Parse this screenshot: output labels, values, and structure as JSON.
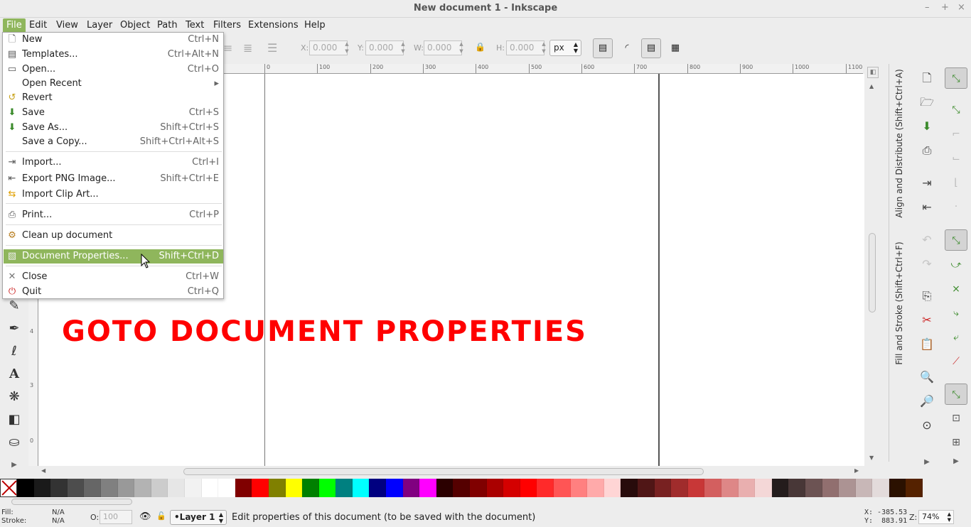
{
  "window": {
    "title": "New document 1 - Inkscape",
    "controls": [
      "–",
      "+",
      "×"
    ]
  },
  "menubar": [
    "File",
    "Edit",
    "View",
    "Layer",
    "Object",
    "Path",
    "Text",
    "Filters",
    "Extensions",
    "Help"
  ],
  "file_menu": {
    "items": [
      {
        "label": "New",
        "shortcut": "Ctrl+N",
        "icon": "new-document-icon"
      },
      {
        "label": "Templates...",
        "shortcut": "Ctrl+Alt+N",
        "icon": "templates-icon"
      },
      {
        "label": "Open...",
        "shortcut": "Ctrl+O",
        "icon": "open-folder-icon"
      },
      {
        "label": "Open Recent",
        "shortcut": "▸",
        "icon": ""
      },
      {
        "label": "Revert",
        "shortcut": "",
        "icon": "revert-icon"
      },
      {
        "label": "Save",
        "shortcut": "Ctrl+S",
        "icon": "save-icon"
      },
      {
        "label": "Save As...",
        "shortcut": "Shift+Ctrl+S",
        "icon": "save-as-icon"
      },
      {
        "label": "Save a Copy...",
        "shortcut": "Shift+Ctrl+Alt+S",
        "icon": ""
      },
      {
        "label": "Import...",
        "shortcut": "Ctrl+I",
        "icon": "import-icon"
      },
      {
        "label": "Export PNG Image...",
        "shortcut": "Shift+Ctrl+E",
        "icon": "export-png-icon"
      },
      {
        "label": "Import Clip Art...",
        "shortcut": "",
        "icon": "clip-art-icon"
      },
      {
        "label": "Print...",
        "shortcut": "Ctrl+P",
        "icon": "print-icon"
      },
      {
        "label": "Clean up document",
        "shortcut": "",
        "icon": "cleanup-icon"
      },
      {
        "label": "Document Properties...",
        "shortcut": "Shift+Ctrl+D",
        "icon": "document-properties-icon"
      },
      {
        "label": "Close",
        "shortcut": "Ctrl+W",
        "icon": "close-icon"
      },
      {
        "label": "Quit",
        "shortcut": "Ctrl+Q",
        "icon": "quit-icon"
      }
    ]
  },
  "toolbar": {
    "x_label": "X:",
    "x_value": "0.000",
    "y_label": "Y:",
    "y_value": "0.000",
    "w_label": "W:",
    "w_value": "0.000",
    "h_label": "H:",
    "h_value": "0.000",
    "unit": "px"
  },
  "ruler_ticks": [
    "0",
    "100",
    "200",
    "300",
    "400",
    "500",
    "600",
    "700",
    "800",
    "900",
    "1000",
    "1100"
  ],
  "vruler_ticks": [
    "4",
    "3",
    "0"
  ],
  "canvas": {
    "text": "GOTO DOCUMENT PROPERTIES",
    "text_color": "#ff0000"
  },
  "dock": {
    "align_tab": "Align and Distribute (Shift+Ctrl+A)",
    "fill_tab": "Fill and Stroke (Shift+Ctrl+F)"
  },
  "palette": [
    "#000000",
    "#1a1a1a",
    "#333333",
    "#4d4d4d",
    "#666666",
    "#808080",
    "#999999",
    "#b3b3b3",
    "#cccccc",
    "#e6e6e6",
    "#f2f2f2",
    "#ffffff",
    "#ffffff",
    "#800000",
    "#ff0000",
    "#808000",
    "#ffff00",
    "#008000",
    "#00ff00",
    "#008080",
    "#00ffff",
    "#000080",
    "#0000ff",
    "#800080",
    "#ff00ff",
    "#2b0000",
    "#550000",
    "#800000",
    "#aa0000",
    "#d40000",
    "#ff0000",
    "#ff2a2a",
    "#ff5555",
    "#ff8080",
    "#ffaaaa",
    "#ffd5d5",
    "#280b0b",
    "#501616",
    "#782121",
    "#a02c2c",
    "#c83737",
    "#d35f5f",
    "#de8787",
    "#e9afaf",
    "#f4d7d7",
    "#241c1c",
    "#483737",
    "#6c5353",
    "#916f6f",
    "#ac9393",
    "#c8b7b7",
    "#e3dbdb",
    "#2b1100",
    "#552200"
  ],
  "status": {
    "fill_label": "Fill:",
    "fill_value": "N/A",
    "stroke_label": "Stroke:",
    "stroke_value": "N/A",
    "opacity_label": "O:",
    "opacity_value": "100",
    "layer": "•Layer 1",
    "message": "Edit properties of this document (to be saved with the document)",
    "x_coord": "X: -385.53",
    "y_coord": "Y:  883.91",
    "zoom_label": "Z:",
    "zoom": "74%"
  }
}
